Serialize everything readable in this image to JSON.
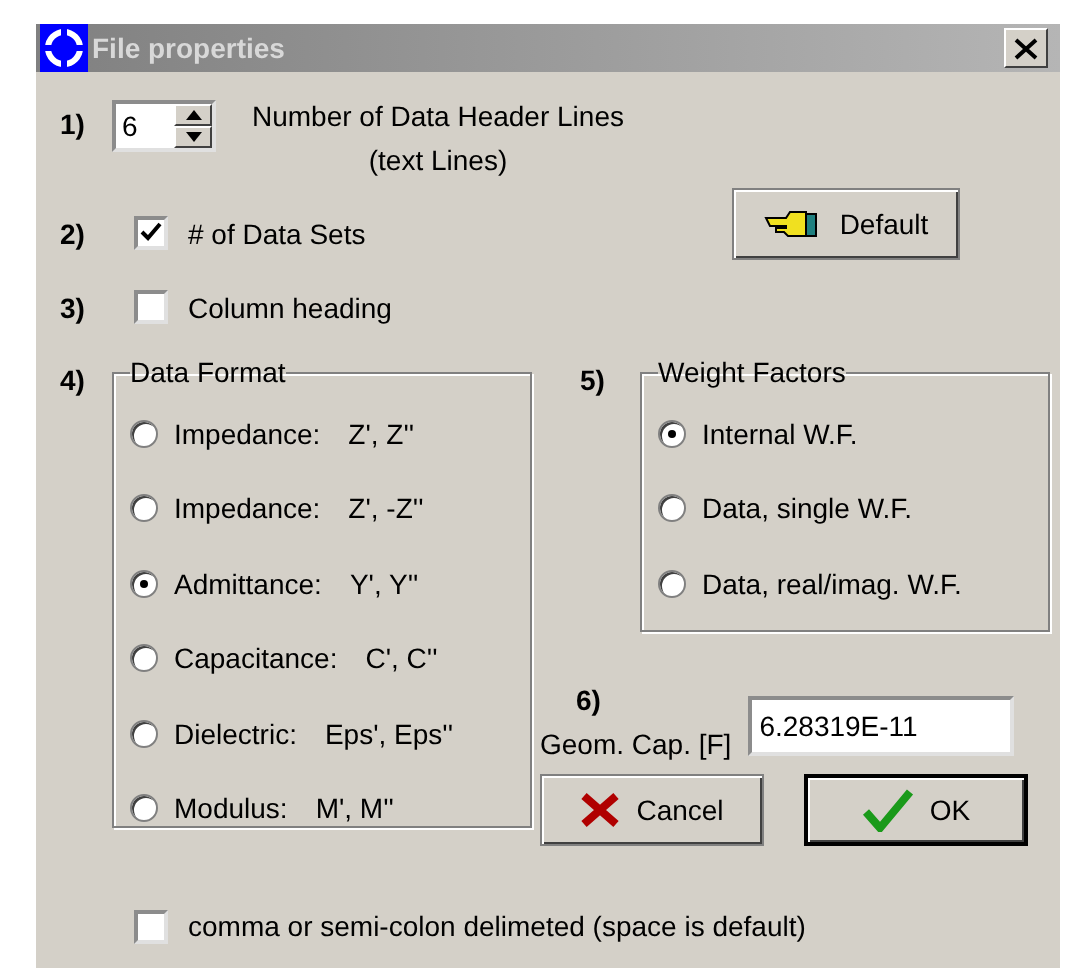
{
  "window": {
    "title": "File properties"
  },
  "header_lines": {
    "number": "1)",
    "value": "6",
    "label": "Number of Data Header Lines",
    "sublabel": "(text Lines)"
  },
  "data_sets": {
    "number": "2)",
    "label": "# of Data Sets",
    "checked": true
  },
  "column_heading": {
    "number": "3)",
    "label": "Column heading",
    "checked": false
  },
  "default_button": {
    "label": "Default"
  },
  "data_format": {
    "number": "4)",
    "title": "Data Format",
    "options": [
      {
        "name": "Impedance:",
        "symbols": "Z', Z''",
        "selected": false
      },
      {
        "name": "Impedance:",
        "symbols": "Z', -Z''",
        "selected": false
      },
      {
        "name": "Admittance:",
        "symbols": "Y', Y''",
        "selected": true
      },
      {
        "name": "Capacitance:",
        "symbols": "C', C''",
        "selected": false
      },
      {
        "name": "Dielectric:",
        "symbols": "Eps', Eps''",
        "selected": false
      },
      {
        "name": "Modulus:",
        "symbols": "M', M''",
        "selected": false
      }
    ]
  },
  "weight_factors": {
    "number": "5)",
    "title": "Weight Factors",
    "options": [
      {
        "label": "Internal W.F.",
        "selected": true
      },
      {
        "label": "Data, single W.F.",
        "selected": false
      },
      {
        "label": "Data, real/imag. W.F.",
        "selected": false
      }
    ]
  },
  "geom_cap": {
    "number": "6)",
    "label": "Geom. Cap. [F]",
    "value": "6.28319E-11"
  },
  "buttons": [
    {
      "label": "Cancel",
      "kind": "cancel",
      "default": false
    },
    {
      "label": "OK",
      "kind": "ok",
      "default": true
    }
  ],
  "delimiter": {
    "label": "comma or semi-colon delimeted (space is default)",
    "checked": false
  }
}
